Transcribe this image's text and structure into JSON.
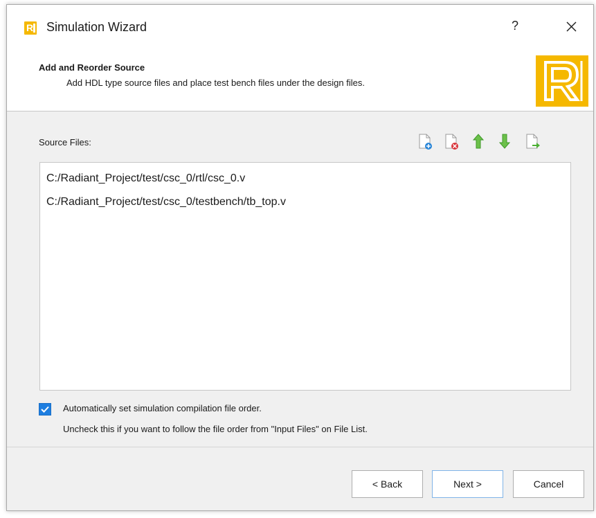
{
  "window": {
    "title": "Simulation Wizard",
    "help_label": "?",
    "close_label": "×"
  },
  "header": {
    "title": "Add and Reorder Source",
    "subtitle": "Add HDL type source files and place test bench files under the design files."
  },
  "source": {
    "label": "Source Files:",
    "toolbar_icons": [
      "add-file-icon",
      "remove-file-icon",
      "move-up-icon",
      "move-down-icon",
      "import-file-icon"
    ],
    "files": [
      "C:/Radiant_Project/test/csc_0/rtl/csc_0.v",
      "C:/Radiant_Project/test/csc_0/testbench/tb_top.v"
    ]
  },
  "options": {
    "auto_order_checked": true,
    "auto_order_label": "Automatically set simulation compilation file order.",
    "hint": "Uncheck this if you want to follow the file order from \"Input Files\" on File List."
  },
  "buttons": {
    "back": "< Back",
    "next": "Next >",
    "cancel": "Cancel"
  },
  "colors": {
    "brand": "#f5b800",
    "checkbox": "#1e7ee0",
    "arrow_green": "#5cb83a",
    "remove_red": "#d9343a",
    "add_blue": "#2a86d8"
  }
}
